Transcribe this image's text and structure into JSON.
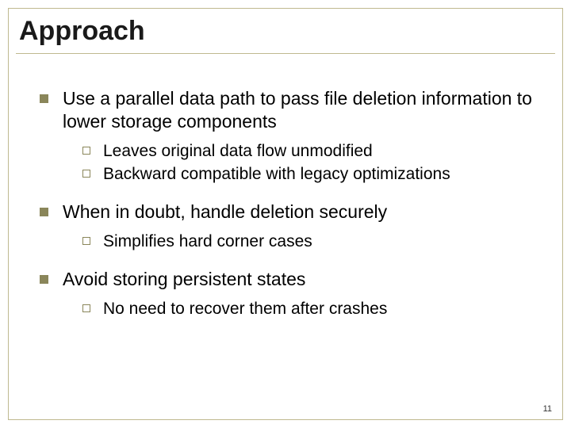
{
  "title": "Approach",
  "bullets": [
    {
      "text": "Use a parallel data path to pass file deletion information to lower storage components",
      "sub": [
        "Leaves original data flow unmodified",
        "Backward compatible with legacy optimizations"
      ]
    },
    {
      "text": "When in doubt, handle deletion securely",
      "sub": [
        "Simplifies hard corner cases"
      ]
    },
    {
      "text": "Avoid storing persistent states",
      "sub": [
        "No need to recover them after crashes"
      ]
    }
  ],
  "page_number": "11"
}
